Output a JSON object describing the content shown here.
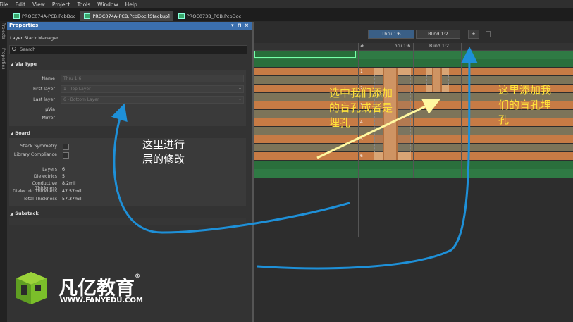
{
  "menubar": {
    "items": [
      "File",
      "Edit",
      "View",
      "Project",
      "Tools",
      "Window",
      "Help"
    ]
  },
  "tabs": [
    {
      "label": "PROC074A-PCB.PcbDoc",
      "active": false
    },
    {
      "label": "PROC074A-PCB.PcbDoc [Stackup]",
      "active": true
    },
    {
      "label": "PROC073B_PCB.PcbDoc",
      "active": false
    }
  ],
  "side_rail": {
    "items": [
      "Projects",
      "Properties"
    ]
  },
  "panel": {
    "title": "Properties",
    "controls": [
      "▾",
      "⊓",
      "×"
    ],
    "subtitle": "Layer Stack Manager",
    "search_placeholder": "Search",
    "via_type": {
      "header": "Via Type",
      "name_label": "Name",
      "name_value": "Thru 1:6",
      "first_layer_label": "First layer",
      "first_layer_value": "1 - Top Layer",
      "last_layer_label": "Last layer",
      "last_layer_value": "6 - Bottom Layer",
      "uvia_label": "μVia",
      "mirror_label": "Mirror"
    },
    "board": {
      "header": "Board",
      "stack_symmetry_label": "Stack Symmetry",
      "library_compliance_label": "Library Compliance",
      "stats": [
        {
          "label": "Layers",
          "value": "6"
        },
        {
          "label": "Dielectrics",
          "value": "5"
        },
        {
          "label": "Conductive Thickness",
          "value": "8.2mil"
        },
        {
          "label": "Dielectric Thickness",
          "value": "47.57mil"
        },
        {
          "label": "Total Thickness",
          "value": "57.37mil"
        }
      ]
    },
    "substack": {
      "header": "Substack"
    }
  },
  "stackup": {
    "via_tabs": [
      {
        "label": "Thru 1:6",
        "active": true
      },
      {
        "label": "Blind 1:2",
        "active": false
      }
    ],
    "add_button": "+",
    "columns": {
      "num": "#",
      "thru": "Thru 1:6",
      "blind": "Blind 1:2"
    },
    "layer_numbers": [
      "1",
      "2",
      "3",
      "4",
      "5",
      "6"
    ]
  },
  "annotations": {
    "left_note": [
      "这里进行",
      "层的修改"
    ],
    "middle_note": [
      "选中我们添加",
      "的盲孔或者是",
      "埋孔"
    ],
    "right_note": [
      "这里添加我",
      "们的盲孔埋",
      "孔"
    ]
  },
  "watermark": {
    "brand": "凡亿教育",
    "reg": "®",
    "url": "WWW.FANYEDU.COM"
  },
  "colors": {
    "panel_header": "#3b6fae",
    "copper": "#c77b45",
    "dielectric": "#7d7459",
    "mask": "#2f7a44",
    "arrow": "#1e90d8",
    "highlight_arrow": "#fff8a0",
    "annotation_yellow": "#ffe23a",
    "brand_green": "#7bbf2a"
  }
}
